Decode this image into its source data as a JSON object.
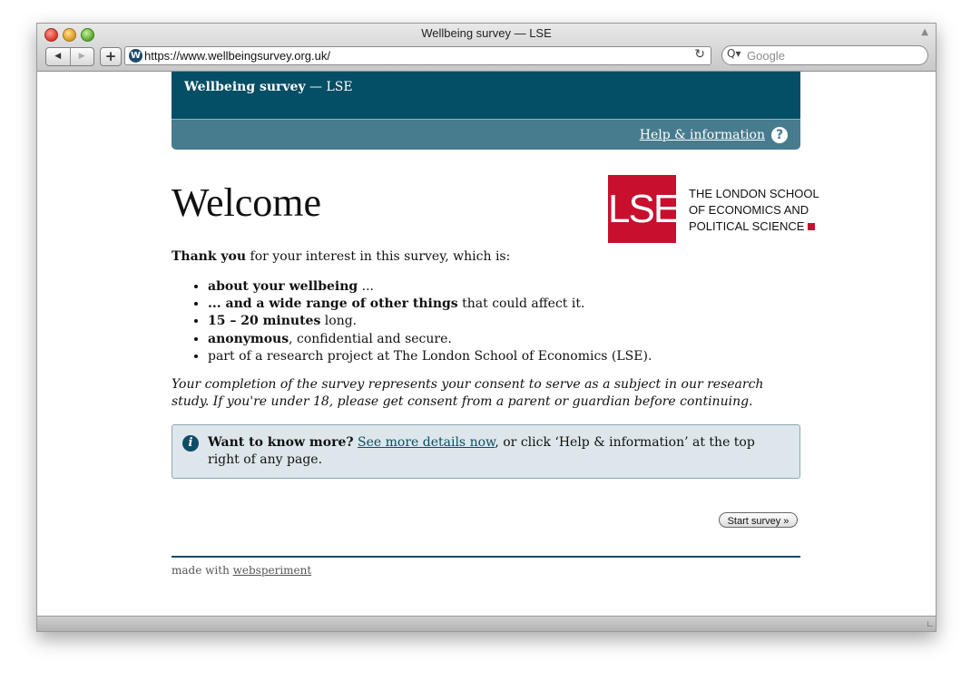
{
  "browser": {
    "window_title": "Wellbeing survey — LSE",
    "back_glyph": "◀",
    "forward_glyph": "▶",
    "add_glyph": "+",
    "favicon_letter": "W",
    "url": "https://www.wellbeingsurvey.org.uk/",
    "reload_glyph": "↻",
    "search_placeholder": "Google",
    "search_glyph": "Q▾"
  },
  "header": {
    "title_bold": "Wellbeing survey",
    "title_rest": " — LSE",
    "help_link": "Help & information",
    "help_icon_glyph": "?"
  },
  "main": {
    "heading": "Welcome",
    "logo": {
      "mark": "LSE",
      "line1": "THE LONDON SCHOOL",
      "line2": "OF ECONOMICS AND",
      "line3": "POLITICAL SCIENCE",
      "color": "#c8102e"
    },
    "intro_bold": "Thank you",
    "intro_rest": " for your interest in this survey, which is:",
    "bullets": [
      {
        "bold": "about your wellbeing",
        "rest": " ..."
      },
      {
        "pre": "... ",
        "bold": "and a wide range of other things",
        "rest": " that could affect it."
      },
      {
        "bold": "15 – 20 minutes",
        "rest": " long."
      },
      {
        "bold": "anonymous",
        "rest": ", confidential and secure."
      },
      {
        "rest": "part of a research project at The London School of Economics (LSE)."
      }
    ],
    "consent": "Your completion of the survey represents your consent to serve as a subject in our research study. If you're under 18, please get consent from a parent or guardian before continuing.",
    "info": {
      "icon_glyph": "i",
      "bold": "Want to know more?",
      "link": "See more details now",
      "rest": ", or click ‘Help & information’ at the top right of any page."
    },
    "start_button": "Start survey »"
  },
  "footer": {
    "text": "made with ",
    "link": "websperiment"
  },
  "colors": {
    "banner": "#044e66",
    "subbar": "#477b8e",
    "infobox": "#dde7eb",
    "accent": "#0d4c66"
  }
}
